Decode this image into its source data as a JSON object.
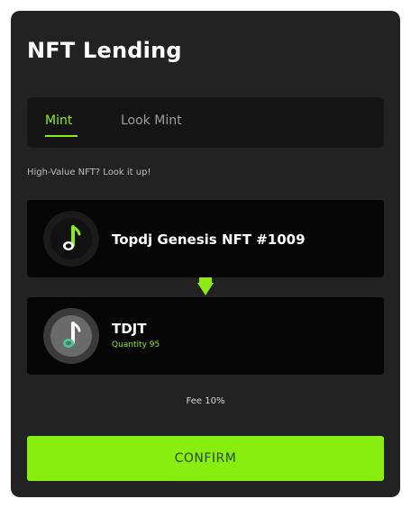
{
  "header": {
    "title": "NFT Lending"
  },
  "tabs": [
    {
      "label": "Mint",
      "active": true
    },
    {
      "label": "Look Mint",
      "active": false
    }
  ],
  "subtitle": "High-Value NFT? Look it up!",
  "nft": {
    "name": "Topdj Genesis NFT #1009",
    "icon": "music-note-icon"
  },
  "swap": {
    "icon": "triangle-down-icon"
  },
  "token": {
    "symbol": "TDJT",
    "quantity_label": "Quantity 95",
    "icon": "music-note-icon"
  },
  "fee": "Fee 10%",
  "confirm_label": "CONFIRM",
  "colors": {
    "accent": "#8eea14",
    "card": "#222222",
    "panel": "#050505",
    "button": "#88ee10"
  }
}
